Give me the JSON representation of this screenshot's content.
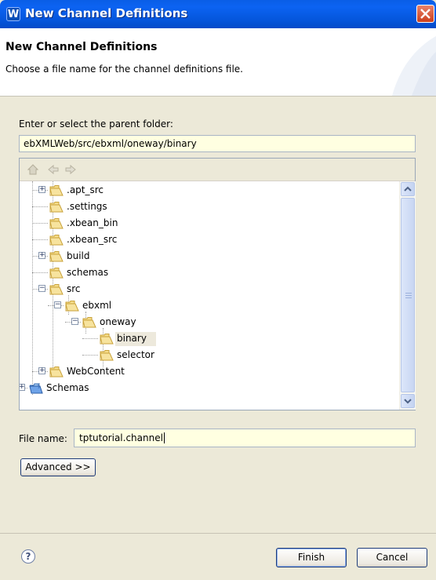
{
  "window": {
    "title": "New Channel Definitions"
  },
  "banner": {
    "title": "New Channel Definitions",
    "description": "Choose a file name for the channel definitions file."
  },
  "parent_folder": {
    "label": "Enter or select the parent folder:",
    "value": "ebXMLWeb/src/ebxml/oneway/binary"
  },
  "tree": {
    "toolbar": [
      "home-icon",
      "back-icon",
      "forward-icon"
    ],
    "items": [
      {
        "label": ".apt_src",
        "expandable": true,
        "expanded": false
      },
      {
        "label": ".settings",
        "expandable": false
      },
      {
        "label": ".xbean_bin",
        "expandable": false
      },
      {
        "label": ".xbean_src",
        "expandable": false
      },
      {
        "label": "build",
        "expandable": true,
        "expanded": false
      },
      {
        "label": "schemas",
        "expandable": false
      },
      {
        "label": "src",
        "expandable": true,
        "expanded": true
      },
      {
        "label": "ebxml",
        "expandable": true,
        "expanded": true
      },
      {
        "label": "oneway",
        "expandable": true,
        "expanded": true
      },
      {
        "label": "binary",
        "expandable": false,
        "selected": true
      },
      {
        "label": "selector",
        "expandable": false
      },
      {
        "label": "WebContent",
        "expandable": true,
        "expanded": false
      },
      {
        "label": "Schemas",
        "expandable": true,
        "expanded": false
      }
    ]
  },
  "file_name": {
    "label": "File name:",
    "value": "tptutorial.channel"
  },
  "buttons": {
    "advanced": "Advanced >>",
    "finish": "Finish",
    "cancel": "Cancel"
  },
  "colors": {
    "titlebar": "#0556dc",
    "input_bg": "#ffffe1",
    "dialog_bg": "#ece9d8"
  }
}
